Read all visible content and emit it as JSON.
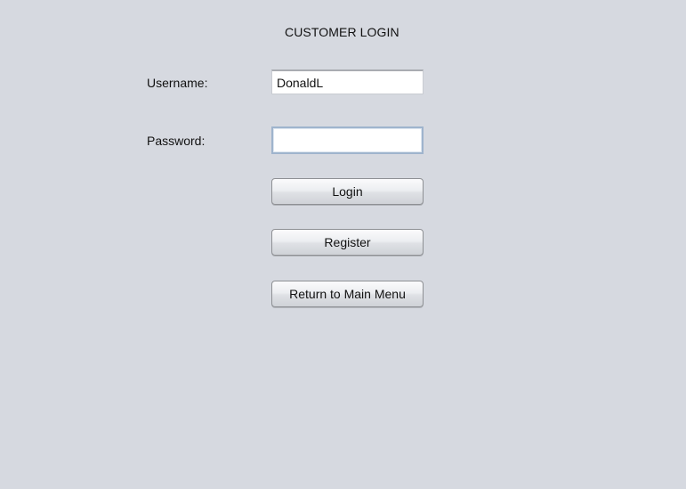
{
  "screen": {
    "title": "CUSTOMER LOGIN"
  },
  "form": {
    "username_label": "Username:",
    "username_value": "DonaldL",
    "password_label": "Password:",
    "password_value": ""
  },
  "buttons": {
    "login": "Login",
    "register": "Register",
    "return_main_menu": "Return to Main Menu"
  },
  "colors": {
    "background": "#d6d9e0",
    "focus_border": "#9fb4cd"
  }
}
